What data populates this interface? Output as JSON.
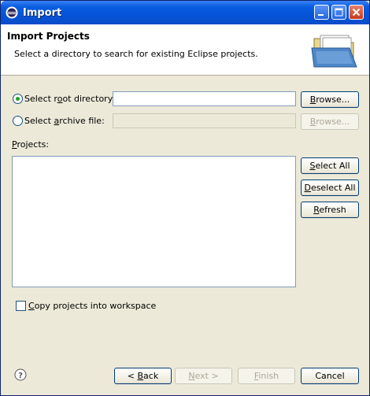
{
  "window": {
    "title": "Import"
  },
  "header": {
    "title": "Import Projects",
    "message": "Select a directory to search for existing Eclipse projects."
  },
  "root_dir": {
    "label_prefix": "Select r",
    "label_mnemonic": "o",
    "label_suffix": "ot directory:",
    "value": "",
    "selected": true
  },
  "archive": {
    "label_prefix": "Select ",
    "label_mnemonic": "a",
    "label_suffix": "rchive file:",
    "value": "",
    "selected": false
  },
  "browse": {
    "mnemonic": "B",
    "rest": "rowse..."
  },
  "projects": {
    "label_mnemonic": "P",
    "label_rest": "rojects:",
    "items": []
  },
  "actions": {
    "select_all": {
      "mnemonic": "S",
      "rest": "elect All"
    },
    "deselect_all": {
      "mnemonic": "D",
      "rest": "eselect All"
    },
    "refresh": {
      "mnemonic": "R",
      "rest": "efresh"
    }
  },
  "copy_projects": {
    "mnemonic": "C",
    "rest": "opy projects into workspace",
    "checked": false
  },
  "footer": {
    "back": {
      "prefix": "< ",
      "mnemonic": "B",
      "rest": "ack"
    },
    "next": {
      "mnemonic": "N",
      "rest": "ext >"
    },
    "finish": {
      "mnemonic": "F",
      "rest": "inish"
    },
    "cancel": "Cancel"
  },
  "icons": {
    "title": "eclipse-icon",
    "header": "folder-icon",
    "help": "help-icon"
  },
  "colors": {
    "titlebar": "#0a5de0",
    "dialog_bg": "#ece9d8",
    "radio_dot": "#21a121"
  }
}
